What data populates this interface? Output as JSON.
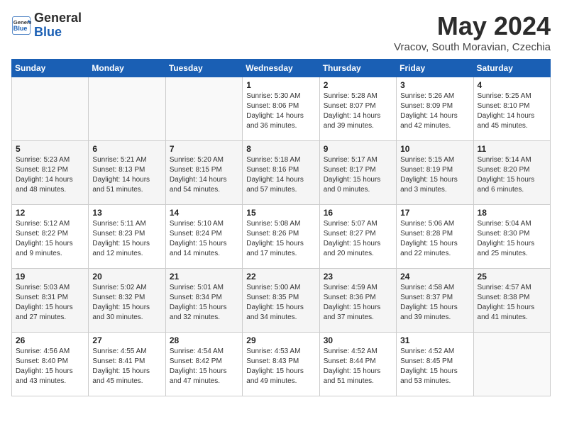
{
  "header": {
    "logo_line1": "General",
    "logo_line2": "Blue",
    "title": "May 2024",
    "subtitle": "Vracov, South Moravian, Czechia"
  },
  "days_of_week": [
    "Sunday",
    "Monday",
    "Tuesday",
    "Wednesday",
    "Thursday",
    "Friday",
    "Saturday"
  ],
  "weeks": [
    {
      "days": [
        {
          "num": "",
          "info": ""
        },
        {
          "num": "",
          "info": ""
        },
        {
          "num": "",
          "info": ""
        },
        {
          "num": "1",
          "info": "Sunrise: 5:30 AM\nSunset: 8:06 PM\nDaylight: 14 hours\nand 36 minutes."
        },
        {
          "num": "2",
          "info": "Sunrise: 5:28 AM\nSunset: 8:07 PM\nDaylight: 14 hours\nand 39 minutes."
        },
        {
          "num": "3",
          "info": "Sunrise: 5:26 AM\nSunset: 8:09 PM\nDaylight: 14 hours\nand 42 minutes."
        },
        {
          "num": "4",
          "info": "Sunrise: 5:25 AM\nSunset: 8:10 PM\nDaylight: 14 hours\nand 45 minutes."
        }
      ]
    },
    {
      "days": [
        {
          "num": "5",
          "info": "Sunrise: 5:23 AM\nSunset: 8:12 PM\nDaylight: 14 hours\nand 48 minutes."
        },
        {
          "num": "6",
          "info": "Sunrise: 5:21 AM\nSunset: 8:13 PM\nDaylight: 14 hours\nand 51 minutes."
        },
        {
          "num": "7",
          "info": "Sunrise: 5:20 AM\nSunset: 8:15 PM\nDaylight: 14 hours\nand 54 minutes."
        },
        {
          "num": "8",
          "info": "Sunrise: 5:18 AM\nSunset: 8:16 PM\nDaylight: 14 hours\nand 57 minutes."
        },
        {
          "num": "9",
          "info": "Sunrise: 5:17 AM\nSunset: 8:17 PM\nDaylight: 15 hours\nand 0 minutes."
        },
        {
          "num": "10",
          "info": "Sunrise: 5:15 AM\nSunset: 8:19 PM\nDaylight: 15 hours\nand 3 minutes."
        },
        {
          "num": "11",
          "info": "Sunrise: 5:14 AM\nSunset: 8:20 PM\nDaylight: 15 hours\nand 6 minutes."
        }
      ]
    },
    {
      "days": [
        {
          "num": "12",
          "info": "Sunrise: 5:12 AM\nSunset: 8:22 PM\nDaylight: 15 hours\nand 9 minutes."
        },
        {
          "num": "13",
          "info": "Sunrise: 5:11 AM\nSunset: 8:23 PM\nDaylight: 15 hours\nand 12 minutes."
        },
        {
          "num": "14",
          "info": "Sunrise: 5:10 AM\nSunset: 8:24 PM\nDaylight: 15 hours\nand 14 minutes."
        },
        {
          "num": "15",
          "info": "Sunrise: 5:08 AM\nSunset: 8:26 PM\nDaylight: 15 hours\nand 17 minutes."
        },
        {
          "num": "16",
          "info": "Sunrise: 5:07 AM\nSunset: 8:27 PM\nDaylight: 15 hours\nand 20 minutes."
        },
        {
          "num": "17",
          "info": "Sunrise: 5:06 AM\nSunset: 8:28 PM\nDaylight: 15 hours\nand 22 minutes."
        },
        {
          "num": "18",
          "info": "Sunrise: 5:04 AM\nSunset: 8:30 PM\nDaylight: 15 hours\nand 25 minutes."
        }
      ]
    },
    {
      "days": [
        {
          "num": "19",
          "info": "Sunrise: 5:03 AM\nSunset: 8:31 PM\nDaylight: 15 hours\nand 27 minutes."
        },
        {
          "num": "20",
          "info": "Sunrise: 5:02 AM\nSunset: 8:32 PM\nDaylight: 15 hours\nand 30 minutes."
        },
        {
          "num": "21",
          "info": "Sunrise: 5:01 AM\nSunset: 8:34 PM\nDaylight: 15 hours\nand 32 minutes."
        },
        {
          "num": "22",
          "info": "Sunrise: 5:00 AM\nSunset: 8:35 PM\nDaylight: 15 hours\nand 34 minutes."
        },
        {
          "num": "23",
          "info": "Sunrise: 4:59 AM\nSunset: 8:36 PM\nDaylight: 15 hours\nand 37 minutes."
        },
        {
          "num": "24",
          "info": "Sunrise: 4:58 AM\nSunset: 8:37 PM\nDaylight: 15 hours\nand 39 minutes."
        },
        {
          "num": "25",
          "info": "Sunrise: 4:57 AM\nSunset: 8:38 PM\nDaylight: 15 hours\nand 41 minutes."
        }
      ]
    },
    {
      "days": [
        {
          "num": "26",
          "info": "Sunrise: 4:56 AM\nSunset: 8:40 PM\nDaylight: 15 hours\nand 43 minutes."
        },
        {
          "num": "27",
          "info": "Sunrise: 4:55 AM\nSunset: 8:41 PM\nDaylight: 15 hours\nand 45 minutes."
        },
        {
          "num": "28",
          "info": "Sunrise: 4:54 AM\nSunset: 8:42 PM\nDaylight: 15 hours\nand 47 minutes."
        },
        {
          "num": "29",
          "info": "Sunrise: 4:53 AM\nSunset: 8:43 PM\nDaylight: 15 hours\nand 49 minutes."
        },
        {
          "num": "30",
          "info": "Sunrise: 4:52 AM\nSunset: 8:44 PM\nDaylight: 15 hours\nand 51 minutes."
        },
        {
          "num": "31",
          "info": "Sunrise: 4:52 AM\nSunset: 8:45 PM\nDaylight: 15 hours\nand 53 minutes."
        },
        {
          "num": "",
          "info": ""
        }
      ]
    }
  ]
}
